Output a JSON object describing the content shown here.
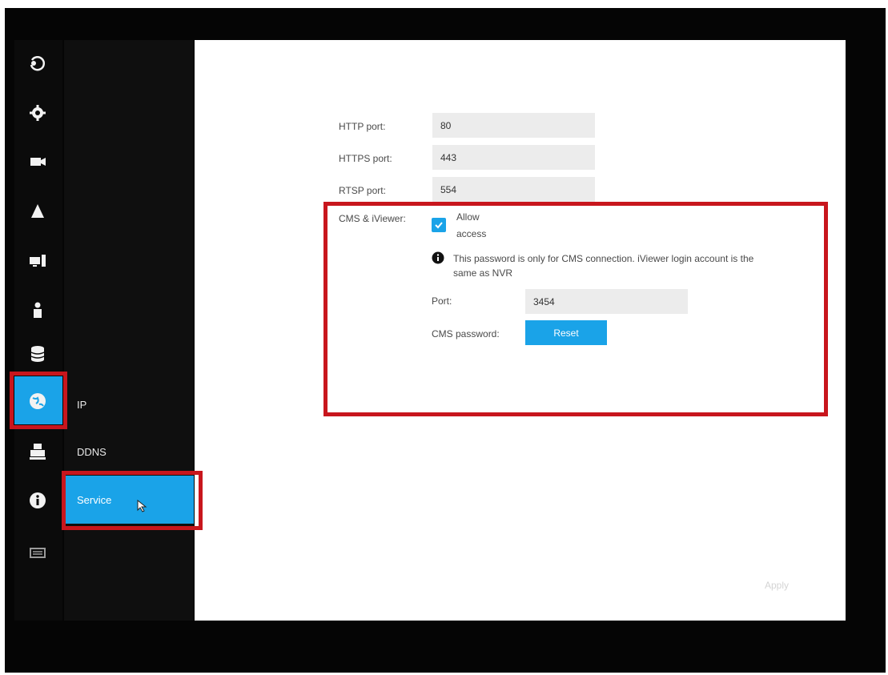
{
  "sidebar_icons": [
    "playback-icon",
    "settings-gear-icon",
    "camera-icon",
    "alarm-bell-icon",
    "device-icon",
    "user-icon",
    "storage-database-icon",
    "network-globe-icon",
    "print-icon",
    "info-icon",
    "keyboard-icon"
  ],
  "subnav": {
    "items": [
      {
        "label": "IP"
      },
      {
        "label": "DDNS"
      },
      {
        "label": "Service"
      }
    ]
  },
  "form": {
    "http_port": {
      "label": "HTTP port:",
      "value": "80"
    },
    "https_port": {
      "label": "HTTPS port:",
      "value": "443"
    },
    "rtsp_port": {
      "label": "RTSP port:",
      "value": "554"
    },
    "cms_label": "CMS & iViewer:",
    "allow_label_1": "Allow",
    "allow_label_2": "access",
    "allow_checked": true,
    "info_text_1": "This password is only for CMS connection. iViewer login account is the",
    "info_text_2": "same as NVR",
    "port": {
      "label": "Port:",
      "value": "3454"
    },
    "cms_password_label": "CMS password:",
    "reset_label": "Reset"
  },
  "apply_label": "Apply",
  "colors": {
    "accent": "#1aa3e8",
    "highlight": "#c8161d",
    "sidebar": "#0b0b0b"
  }
}
